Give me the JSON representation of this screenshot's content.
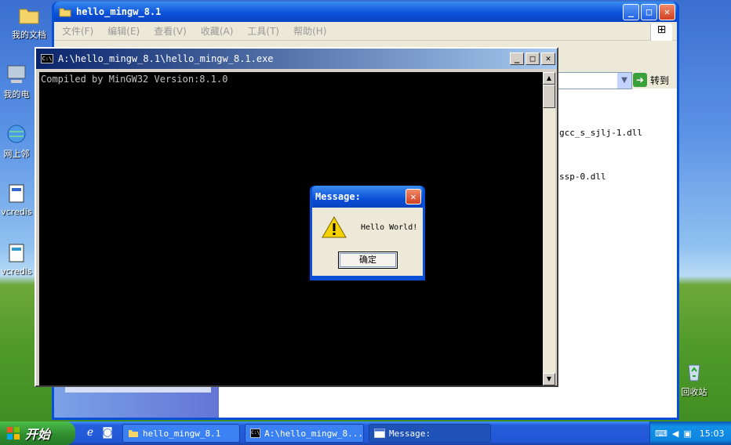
{
  "desktop": {
    "icons": [
      {
        "label": "我的文档"
      },
      {
        "label": "我的电"
      },
      {
        "label": "网上邻"
      },
      {
        "label": "vcredis"
      },
      {
        "label": "vcredis"
      },
      {
        "label": "回收站"
      }
    ]
  },
  "explorer": {
    "title": "hello_mingw_8.1",
    "menu": [
      "文件(F)",
      "编辑(E)",
      "查看(V)",
      "收藏(A)",
      "工具(T)",
      "帮助(H)"
    ],
    "goto_label": "转到",
    "files": [
      "gcc_s_sjlj-1.dll",
      "ssp-0.dll"
    ]
  },
  "console": {
    "title": "A:\\hello_mingw_8.1\\hello_mingw_8.1.exe",
    "output": "Compiled by MinGW32 Version:8.1.0"
  },
  "msgbox": {
    "title": "Message:",
    "text": "Hello World!",
    "ok_label": "确定"
  },
  "taskbar": {
    "start_label": "开始",
    "tasks": [
      {
        "label": "hello_mingw_8.1"
      },
      {
        "label": "A:\\hello_mingw_8..."
      },
      {
        "label": "Message:"
      }
    ],
    "clock": "15:03"
  },
  "colors": {
    "xp_blue": "#0a4fd8",
    "console_bg": "#000000",
    "start_green": "#2e8c2e"
  }
}
